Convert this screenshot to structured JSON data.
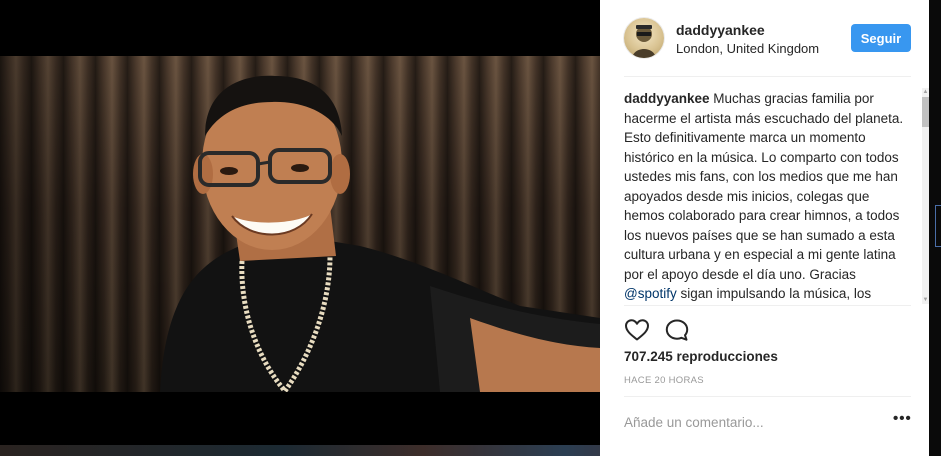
{
  "post": {
    "username": "daddyyankee",
    "location": "London, United Kingdom",
    "follow_label": "Seguir",
    "caption_user": "daddyyankee",
    "caption_text_before": " Muchas gracias familia por hacerme el artista más escuchado del planeta. Esto definitivamente marca un momento histórico en la música. Lo comparto con todos ustedes mis fans, con los medios que me han apoyados desde mis inicios, colegas que hemos colaborado para crear himnos, a todos los nuevos países que se han sumado a esta cultura urbana y en especial a mi gente latina por el apoyo desde el día uno. Gracias ",
    "caption_mention": "@spotify",
    "caption_text_after": " sigan impulsando la música, los talentos y",
    "views": "707.245 reproducciones",
    "time_ago": "HACE 20 HORAS",
    "comment_placeholder": "Añade un comentario...",
    "more_symbol": "•••"
  },
  "icons": {
    "like": "heart-icon",
    "comment": "comment-bubble-icon",
    "more": "more-options-icon",
    "avatar": "profile-avatar"
  },
  "colors": {
    "follow_button": "#3897f0",
    "mention": "#003569",
    "muted_text": "#999999",
    "panel_bg": "#ffffff"
  }
}
